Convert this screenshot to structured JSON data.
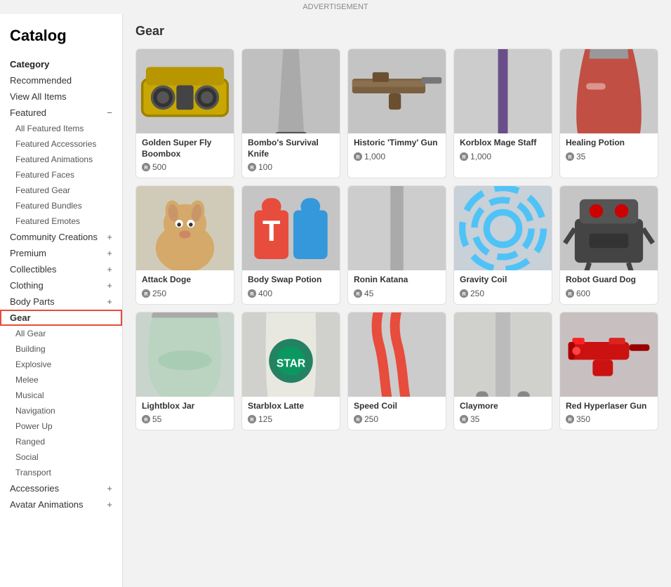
{
  "page": {
    "title": "Catalog",
    "ad_label": "ADVERTISEMENT"
  },
  "sidebar": {
    "category_label": "Category",
    "items": [
      {
        "id": "recommended",
        "label": "Recommended",
        "indent": false,
        "expandable": false
      },
      {
        "id": "view-all",
        "label": "View All Items",
        "indent": false,
        "expandable": false
      },
      {
        "id": "featured",
        "label": "Featured",
        "indent": false,
        "expandable": true,
        "expanded": true,
        "toggle": "−"
      },
      {
        "id": "all-featured",
        "label": "All Featured Items",
        "indent": true
      },
      {
        "id": "featured-accessories",
        "label": "Featured Accessories",
        "indent": true
      },
      {
        "id": "featured-animations",
        "label": "Featured Animations",
        "indent": true
      },
      {
        "id": "featured-faces",
        "label": "Featured Faces",
        "indent": true
      },
      {
        "id": "featured-gear",
        "label": "Featured Gear",
        "indent": true
      },
      {
        "id": "featured-bundles",
        "label": "Featured Bundles",
        "indent": true
      },
      {
        "id": "featured-emotes",
        "label": "Featured Emotes",
        "indent": true
      },
      {
        "id": "community-creations",
        "label": "Community Creations",
        "indent": false,
        "expandable": true,
        "toggle": "+"
      },
      {
        "id": "premium",
        "label": "Premium",
        "indent": false,
        "expandable": true,
        "toggle": "+"
      },
      {
        "id": "collectibles",
        "label": "Collectibles",
        "indent": false,
        "expandable": true,
        "toggle": "+"
      },
      {
        "id": "clothing",
        "label": "Clothing",
        "indent": false,
        "expandable": true,
        "toggle": "+"
      },
      {
        "id": "body-parts",
        "label": "Body Parts",
        "indent": false,
        "expandable": true,
        "toggle": "+"
      },
      {
        "id": "gear",
        "label": "Gear",
        "indent": false,
        "expandable": false,
        "active": true
      },
      {
        "id": "all-gear",
        "label": "All Gear",
        "indent": true
      },
      {
        "id": "building",
        "label": "Building",
        "indent": true
      },
      {
        "id": "explosive",
        "label": "Explosive",
        "indent": true
      },
      {
        "id": "melee",
        "label": "Melee",
        "indent": true
      },
      {
        "id": "musical",
        "label": "Musical",
        "indent": true
      },
      {
        "id": "navigation",
        "label": "Navigation",
        "indent": true
      },
      {
        "id": "power-up",
        "label": "Power Up",
        "indent": true
      },
      {
        "id": "ranged",
        "label": "Ranged",
        "indent": true
      },
      {
        "id": "social",
        "label": "Social",
        "indent": true
      },
      {
        "id": "transport",
        "label": "Transport",
        "indent": true
      },
      {
        "id": "accessories",
        "label": "Accessories",
        "indent": false,
        "expandable": true,
        "toggle": "+"
      },
      {
        "id": "avatar-animations",
        "label": "Avatar Animations",
        "indent": false,
        "expandable": true,
        "toggle": "+"
      }
    ]
  },
  "content": {
    "section_title": "Gear",
    "items": [
      {
        "id": 1,
        "name": "Golden Super Fly Boombox",
        "price": "500",
        "img_class": "img-boombox"
      },
      {
        "id": 2,
        "name": "Bombo's Survival Knife",
        "price": "100",
        "img_class": "img-knife"
      },
      {
        "id": 3,
        "name": "Historic 'Timmy' Gun",
        "price": "1,000",
        "img_class": "img-gun"
      },
      {
        "id": 4,
        "name": "Korblox Mage Staff",
        "price": "1,000",
        "img_class": "img-staff"
      },
      {
        "id": 5,
        "name": "Healing Potion",
        "price": "35",
        "img_class": "img-potion"
      },
      {
        "id": 6,
        "name": "Attack Doge",
        "price": "250",
        "img_class": "img-doge"
      },
      {
        "id": 7,
        "name": "Body Swap Potion",
        "price": "400",
        "img_class": "img-bodyswap"
      },
      {
        "id": 8,
        "name": "Ronin Katana",
        "price": "45",
        "img_class": "img-katana"
      },
      {
        "id": 9,
        "name": "Gravity Coil",
        "price": "250",
        "img_class": "img-coil"
      },
      {
        "id": 10,
        "name": "Robot Guard Dog",
        "price": "600",
        "img_class": "img-robot"
      },
      {
        "id": 11,
        "name": "Lightblox Jar",
        "price": "55",
        "img_class": "img-jar"
      },
      {
        "id": 12,
        "name": "Starblox Latte",
        "price": "125",
        "img_class": "img-latte"
      },
      {
        "id": 13,
        "name": "Speed Coil",
        "price": "250",
        "img_class": "img-speedcoil"
      },
      {
        "id": 14,
        "name": "Claymore",
        "price": "35",
        "img_class": "img-claymore"
      },
      {
        "id": 15,
        "name": "Red Hyperlaser Gun",
        "price": "350",
        "img_class": "img-hyperlaser"
      }
    ]
  }
}
